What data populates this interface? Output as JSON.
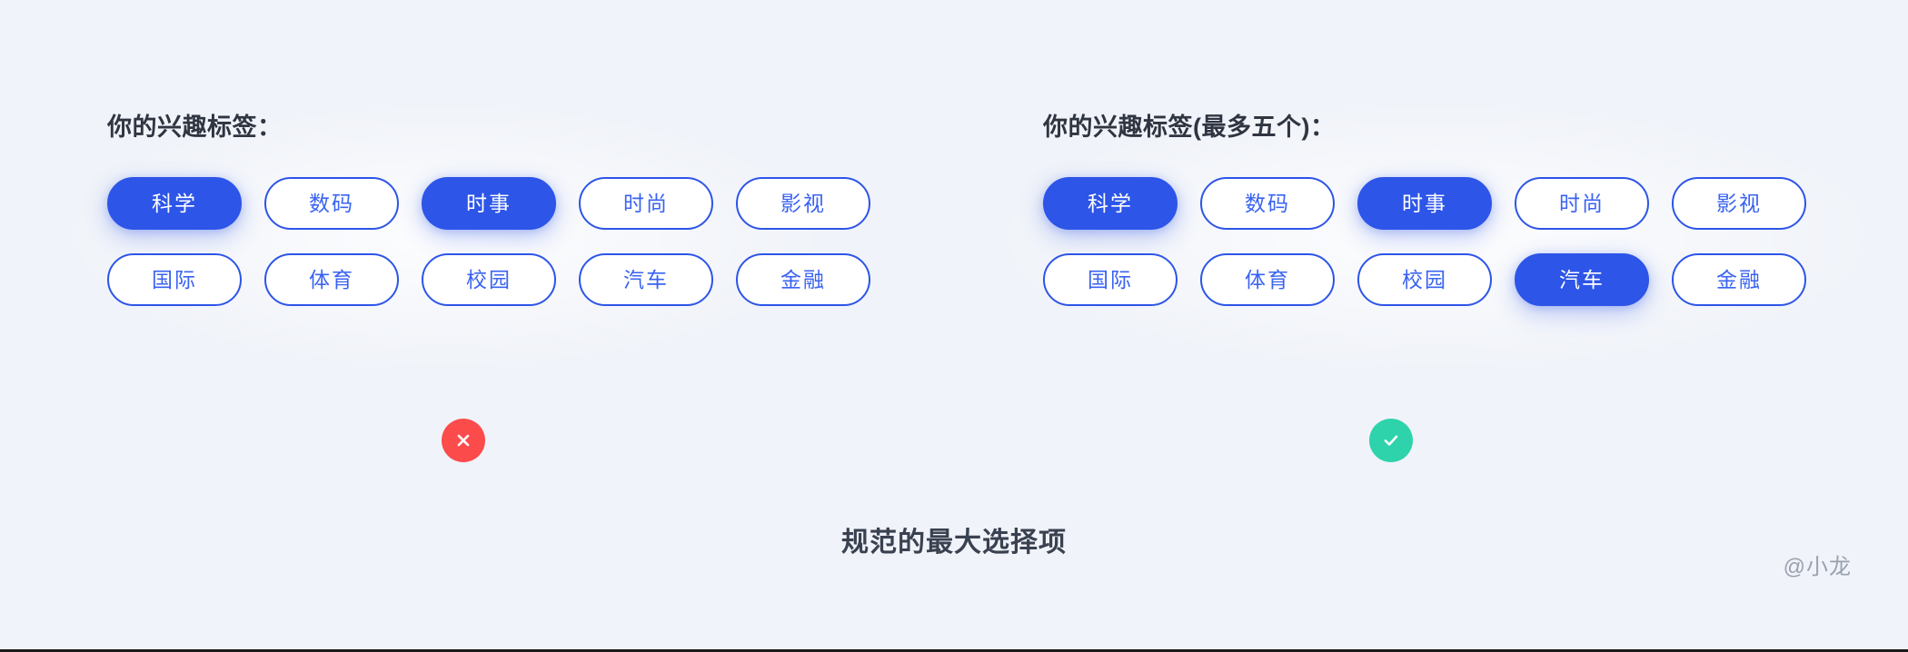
{
  "page": {
    "background_color": "#F0F3F9",
    "caption": "规范的最大选择项",
    "watermark": "@小龙"
  },
  "theme": {
    "accent_blue": "#2D55E8",
    "chip_text_blue": "#3A63F0",
    "invalid_red": "#FC4B4B",
    "valid_green": "#2ED3AB",
    "label_text": "#2F3541",
    "caption_text": "#3A4150",
    "watermark_text": "#9AA1AD",
    "chip_background": "#FFFFFF"
  },
  "panels": [
    {
      "id": "without-limit",
      "label": "你的兴趣标签：",
      "status": {
        "icon": "close-icon",
        "state": "invalid",
        "color": "#FC4B4B"
      },
      "rows": [
        [
          {
            "label": "科学",
            "selected": true
          },
          {
            "label": "数码",
            "selected": false
          },
          {
            "label": "时事",
            "selected": true
          },
          {
            "label": "时尚",
            "selected": false
          },
          {
            "label": "影视",
            "selected": false
          }
        ],
        [
          {
            "label": "国际",
            "selected": false
          },
          {
            "label": "体育",
            "selected": false
          },
          {
            "label": "校园",
            "selected": false
          },
          {
            "label": "汽车",
            "selected": false
          },
          {
            "label": "金融",
            "selected": false
          }
        ]
      ]
    },
    {
      "id": "with-limit",
      "label": "你的兴趣标签(最多五个)：",
      "status": {
        "icon": "check-icon",
        "state": "valid",
        "color": "#2ED3AB"
      },
      "rows": [
        [
          {
            "label": "科学",
            "selected": true
          },
          {
            "label": "数码",
            "selected": false
          },
          {
            "label": "时事",
            "selected": true
          },
          {
            "label": "时尚",
            "selected": false
          },
          {
            "label": "影视",
            "selected": false
          }
        ],
        [
          {
            "label": "国际",
            "selected": false
          },
          {
            "label": "体育",
            "selected": false
          },
          {
            "label": "校园",
            "selected": false
          },
          {
            "label": "汽车",
            "selected": true
          },
          {
            "label": "金融",
            "selected": false
          }
        ]
      ]
    }
  ]
}
